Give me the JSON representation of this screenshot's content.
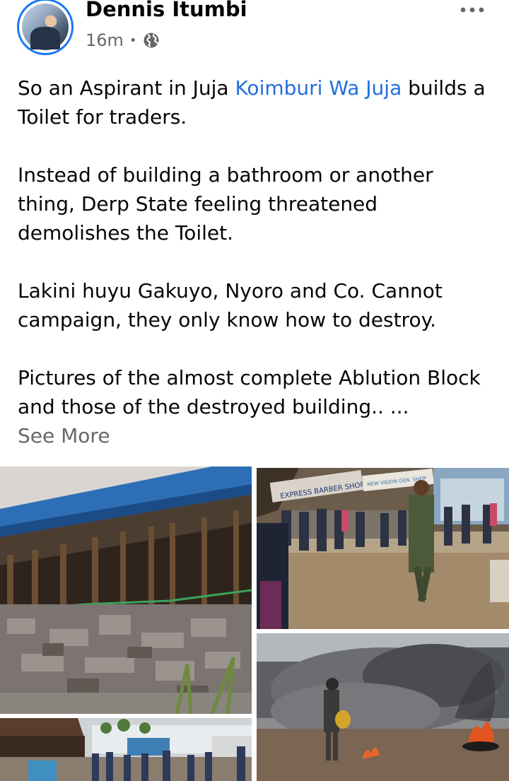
{
  "post": {
    "author": "Dennis Itumbi",
    "time": "16m",
    "separator": "•",
    "privacy_icon": "globe-icon",
    "more_icon": "more-horizontal-icon",
    "paragraph1_prefix": "So an Aspirant in Juja ",
    "paragraph1_link": "Koimburi Wa Juja",
    "paragraph1_suffix": " builds a Toilet for traders.",
    "paragraph2": "Instead of building a bathroom or another thing, Derp State feeling threatened demolishes the Toilet.",
    "paragraph3": "Lakini huyu Gakuyo, Nyoro and Co. Cannot campaign, they only know how to destroy.",
    "paragraph4": "Pictures of the almost complete Ablution Block and those of the destroyed building.. ...",
    "see_more": "See More"
  },
  "photos": {
    "shop_sign_1": "EXPRESS BARBER SHOP",
    "shop_sign_2": "NEW VISION GEN. SHOP"
  },
  "colors": {
    "link": "#216fdb",
    "secondary_text": "#65676b",
    "avatar_ring": "#1877f2"
  }
}
